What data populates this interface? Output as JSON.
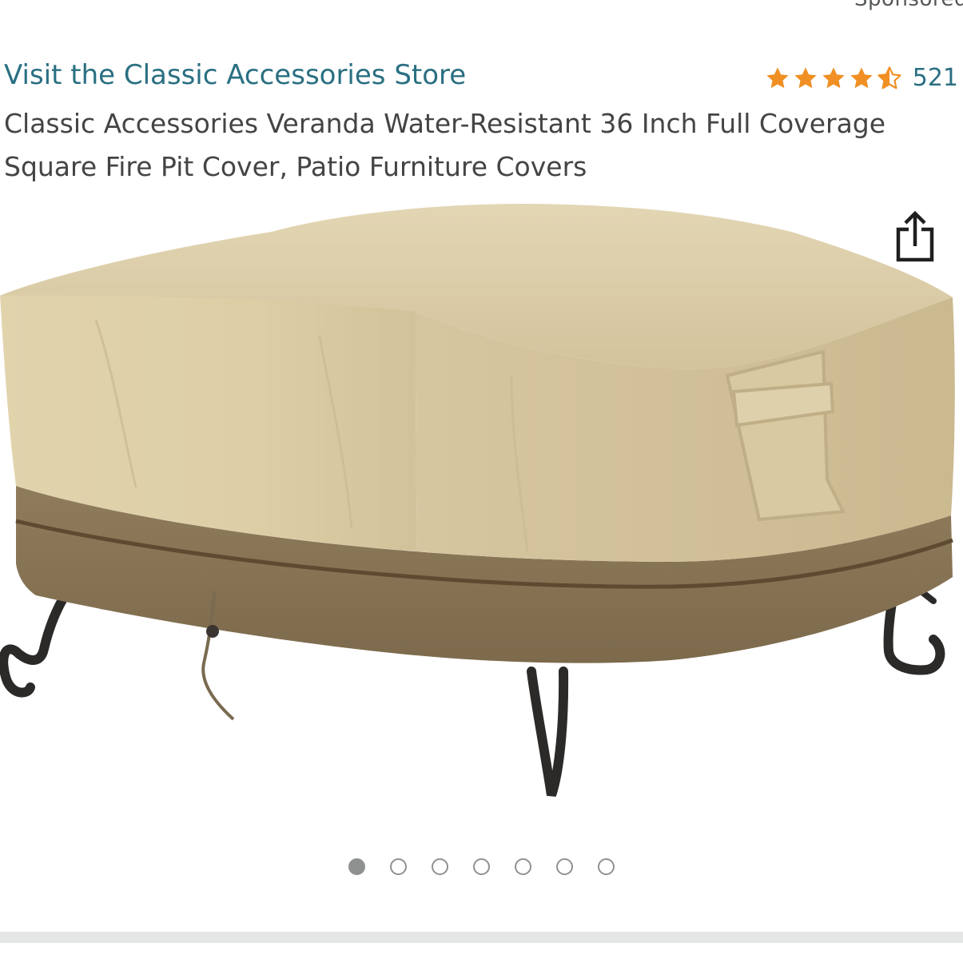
{
  "header": {
    "sponsored_label": "Sponsored",
    "store_link": "Visit the Classic Accessories Store",
    "rating_value": 4.5,
    "rating_max": 5,
    "rating_count": "521"
  },
  "product": {
    "title": "Classic Accessories Veranda Water-Resistant 36 Inch Full Coverage Square Fire Pit Cover, Patio Furniture Covers",
    "image_icon": "square-fire-pit-cover-photo"
  },
  "carousel": {
    "total_images": 7,
    "active_index": 0
  },
  "colors": {
    "link": "#2a6f82",
    "star": "#f08f23",
    "text": "#444444",
    "dot": "#8f9191"
  }
}
